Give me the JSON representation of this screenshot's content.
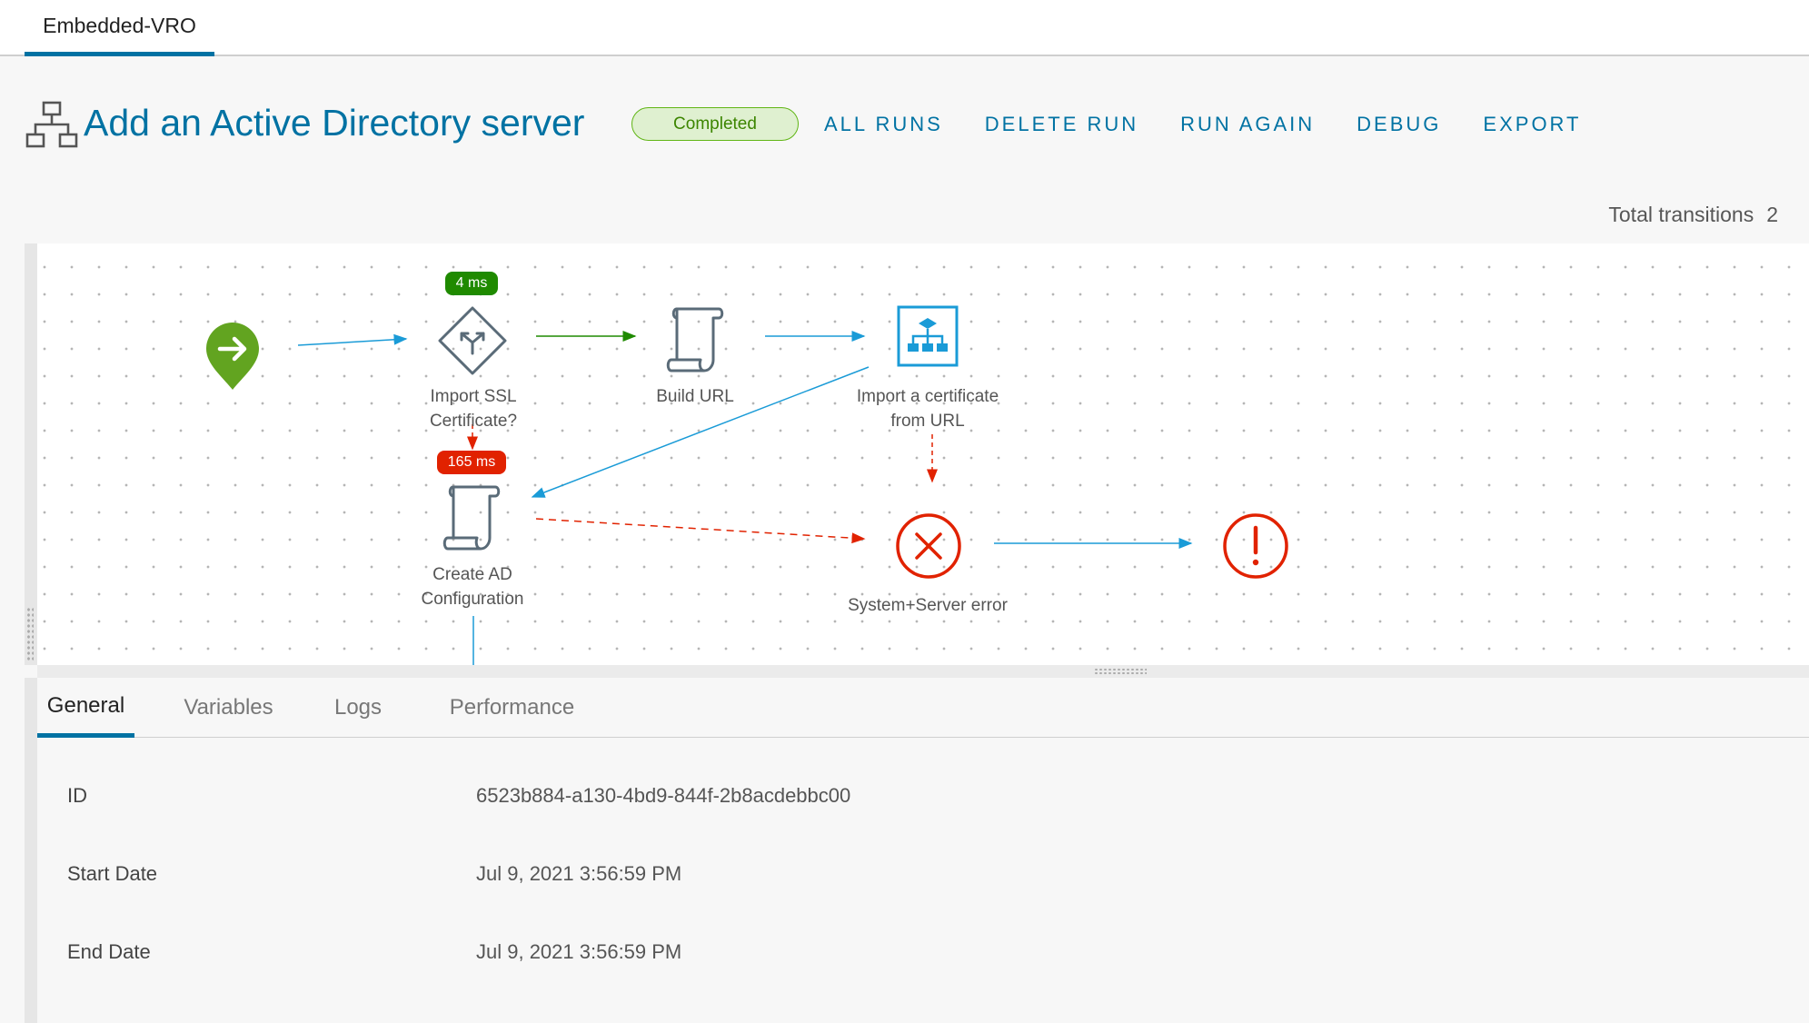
{
  "top_tab": {
    "label": "Embedded-VRO"
  },
  "header": {
    "title": "Add an Active Directory server",
    "status": "Completed",
    "actions": [
      "ALL RUNS",
      "DELETE RUN",
      "RUN AGAIN",
      "DEBUG",
      "EXPORT"
    ]
  },
  "transitions": {
    "label": "Total transitions",
    "count": "2"
  },
  "workflow": {
    "nodes": {
      "start": {
        "icon": "start-arrow-icon"
      },
      "decision": {
        "label_line1": "Import SSL",
        "label_line2": "Certificate?",
        "time": "4 ms",
        "time_color": "#1f8a00"
      },
      "build_url": {
        "label": "Build URL"
      },
      "import_cert": {
        "label_line1": "Import a certificate",
        "label_line2": "from URL"
      },
      "create_ad": {
        "label_line1": "Create AD",
        "label_line2": "Configuration",
        "time": "165 ms",
        "time_color": "#e12200"
      },
      "error_handler": {
        "label": "System+Server error"
      },
      "end_error": {
        "icon": "exclamation-circle-icon"
      }
    },
    "colors": {
      "success": "#1f8a00",
      "normal": "#1a9bd7",
      "error": "#e12200"
    }
  },
  "detail_tabs": [
    "General",
    "Variables",
    "Logs",
    "Performance"
  ],
  "general": {
    "id_label": "ID",
    "id_value": "6523b884-a130-4bd9-844f-2b8acdebbc00",
    "start_label": "Start Date",
    "start_value": "Jul 9, 2021 3:56:59 PM",
    "end_label": "End Date",
    "end_value": "Jul 9, 2021 3:56:59 PM"
  }
}
